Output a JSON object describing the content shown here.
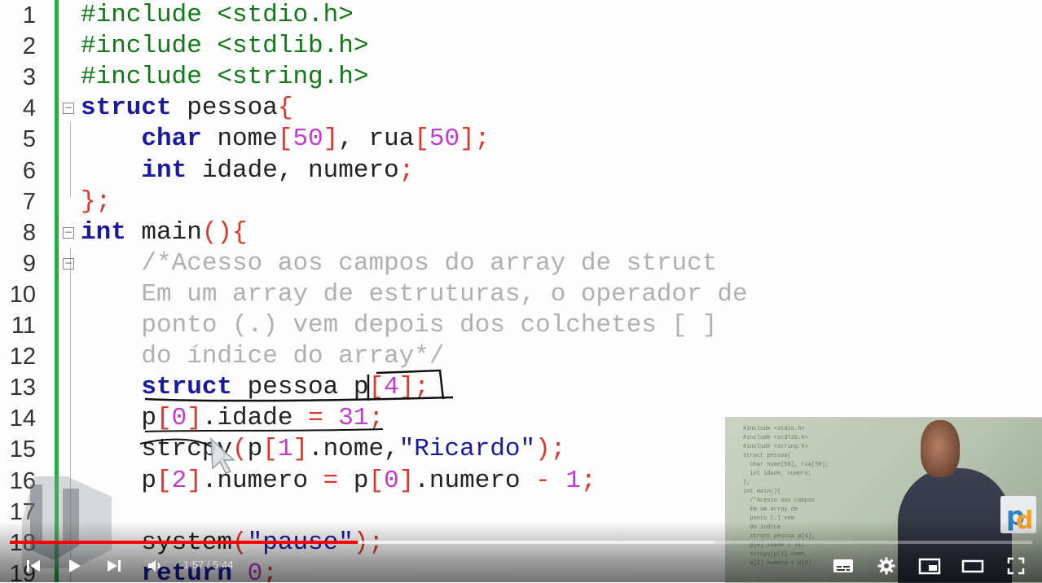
{
  "editor": {
    "lines": [
      {
        "n": "1",
        "fold": "",
        "tokens": [
          [
            "pre",
            "#include <stdio.h>"
          ]
        ]
      },
      {
        "n": "2",
        "fold": "",
        "tokens": [
          [
            "pre",
            "#include <stdlib.h>"
          ]
        ]
      },
      {
        "n": "3",
        "fold": "",
        "tokens": [
          [
            "pre",
            "#include <string.h>"
          ]
        ]
      },
      {
        "n": "4",
        "fold": "⊟",
        "tokens": [
          [
            "kw",
            "struct"
          ],
          [
            "id",
            " pessoa"
          ],
          [
            "sym",
            "{"
          ]
        ]
      },
      {
        "n": "5",
        "fold": "",
        "tokens": [
          [
            "id",
            "    "
          ],
          [
            "kw",
            "char"
          ],
          [
            "id",
            " nome"
          ],
          [
            "sym",
            "["
          ],
          [
            "num",
            "50"
          ],
          [
            "sym",
            "]"
          ],
          [
            "id",
            ", rua"
          ],
          [
            "sym",
            "["
          ],
          [
            "num",
            "50"
          ],
          [
            "sym",
            "];"
          ]
        ]
      },
      {
        "n": "6",
        "fold": "",
        "tokens": [
          [
            "id",
            "    "
          ],
          [
            "kw",
            "int"
          ],
          [
            "id",
            " idade, numero"
          ],
          [
            "sym",
            ";"
          ]
        ]
      },
      {
        "n": "7",
        "fold": "",
        "tokens": [
          [
            "sym",
            "};"
          ]
        ]
      },
      {
        "n": "8",
        "fold": "⊟",
        "tokens": [
          [
            "kw",
            "int"
          ],
          [
            "id",
            " main"
          ],
          [
            "sym",
            "(){"
          ]
        ]
      },
      {
        "n": "9",
        "fold": "⊟",
        "tokens": [
          [
            "id",
            "    "
          ],
          [
            "cm",
            "/*Acesso aos campos do array de struct"
          ]
        ]
      },
      {
        "n": "10",
        "fold": "",
        "tokens": [
          [
            "id",
            "    "
          ],
          [
            "cm",
            "Em um array de estruturas, o operador de"
          ]
        ]
      },
      {
        "n": "11",
        "fold": "",
        "tokens": [
          [
            "id",
            "    "
          ],
          [
            "cm",
            "ponto (.) vem depois dos colchetes [ ]"
          ]
        ]
      },
      {
        "n": "12",
        "fold": "",
        "tokens": [
          [
            "id",
            "    "
          ],
          [
            "cm",
            "do índice do array*/"
          ]
        ]
      },
      {
        "n": "13",
        "fold": "",
        "tokens": [
          [
            "id",
            "    "
          ],
          [
            "kw",
            "struct"
          ],
          [
            "id",
            " pessoa p"
          ],
          [
            "sym",
            "["
          ],
          [
            "num",
            "4"
          ],
          [
            "sym",
            "];"
          ]
        ]
      },
      {
        "n": "14",
        "fold": "",
        "tokens": [
          [
            "id",
            "    p"
          ],
          [
            "sym",
            "["
          ],
          [
            "num",
            "0"
          ],
          [
            "sym",
            "]"
          ],
          [
            "id",
            ".idade "
          ],
          [
            "sym",
            "="
          ],
          [
            "id",
            " "
          ],
          [
            "num",
            "31"
          ],
          [
            "sym",
            ";"
          ]
        ]
      },
      {
        "n": "15",
        "fold": "",
        "tokens": [
          [
            "id",
            "    strcpy"
          ],
          [
            "sym",
            "("
          ],
          [
            "id",
            "p"
          ],
          [
            "sym",
            "["
          ],
          [
            "num",
            "1"
          ],
          [
            "sym",
            "]"
          ],
          [
            "id",
            ".nome,"
          ],
          [
            "str",
            "\"Ricardo\""
          ],
          [
            "sym",
            ");"
          ]
        ]
      },
      {
        "n": "16",
        "fold": "",
        "tokens": [
          [
            "id",
            "    p"
          ],
          [
            "sym",
            "["
          ],
          [
            "num",
            "2"
          ],
          [
            "sym",
            "]"
          ],
          [
            "id",
            ".numero "
          ],
          [
            "sym",
            "="
          ],
          [
            "id",
            " p"
          ],
          [
            "sym",
            "["
          ],
          [
            "num",
            "0"
          ],
          [
            "sym",
            "]"
          ],
          [
            "id",
            ".numero "
          ],
          [
            "sym",
            "-"
          ],
          [
            "id",
            " "
          ],
          [
            "num",
            "1"
          ],
          [
            "sym",
            ";"
          ]
        ]
      },
      {
        "n": "17",
        "fold": "",
        "tokens": []
      },
      {
        "n": "18",
        "fold": "",
        "tokens": [
          [
            "id",
            "    system"
          ],
          [
            "sym",
            "("
          ],
          [
            "str",
            "\"pause\""
          ],
          [
            "sym",
            ");"
          ]
        ]
      },
      {
        "n": "19",
        "fold": "",
        "tokens": [
          [
            "id",
            "    "
          ],
          [
            "kw",
            "return"
          ],
          [
            "id",
            " "
          ],
          [
            "num",
            "0"
          ],
          [
            "sym",
            ";"
          ]
        ]
      }
    ]
  },
  "player": {
    "time_current": "1:57",
    "time_separator": " / ",
    "time_total": "5:44",
    "progress_fraction": 0.34,
    "buffer_fraction": 0.69,
    "accent_color": "#ff0000",
    "icons": {
      "prev": "skip-previous-icon",
      "play": "play-icon",
      "next": "skip-next-icon",
      "volume": "volume-icon",
      "subtitles": "subtitles-icon",
      "settings": "settings-gear-icon",
      "miniplayer": "miniplayer-icon",
      "theater": "theater-mode-icon",
      "fullscreen": "fullscreen-icon"
    }
  },
  "colors": {
    "preprocessor": "#0f7a15",
    "keyword": "#1a1aa0",
    "symbol": "#e0332a",
    "number": "#c23ad0",
    "comment": "#b0b0b0",
    "gutter": "#1db53a"
  }
}
